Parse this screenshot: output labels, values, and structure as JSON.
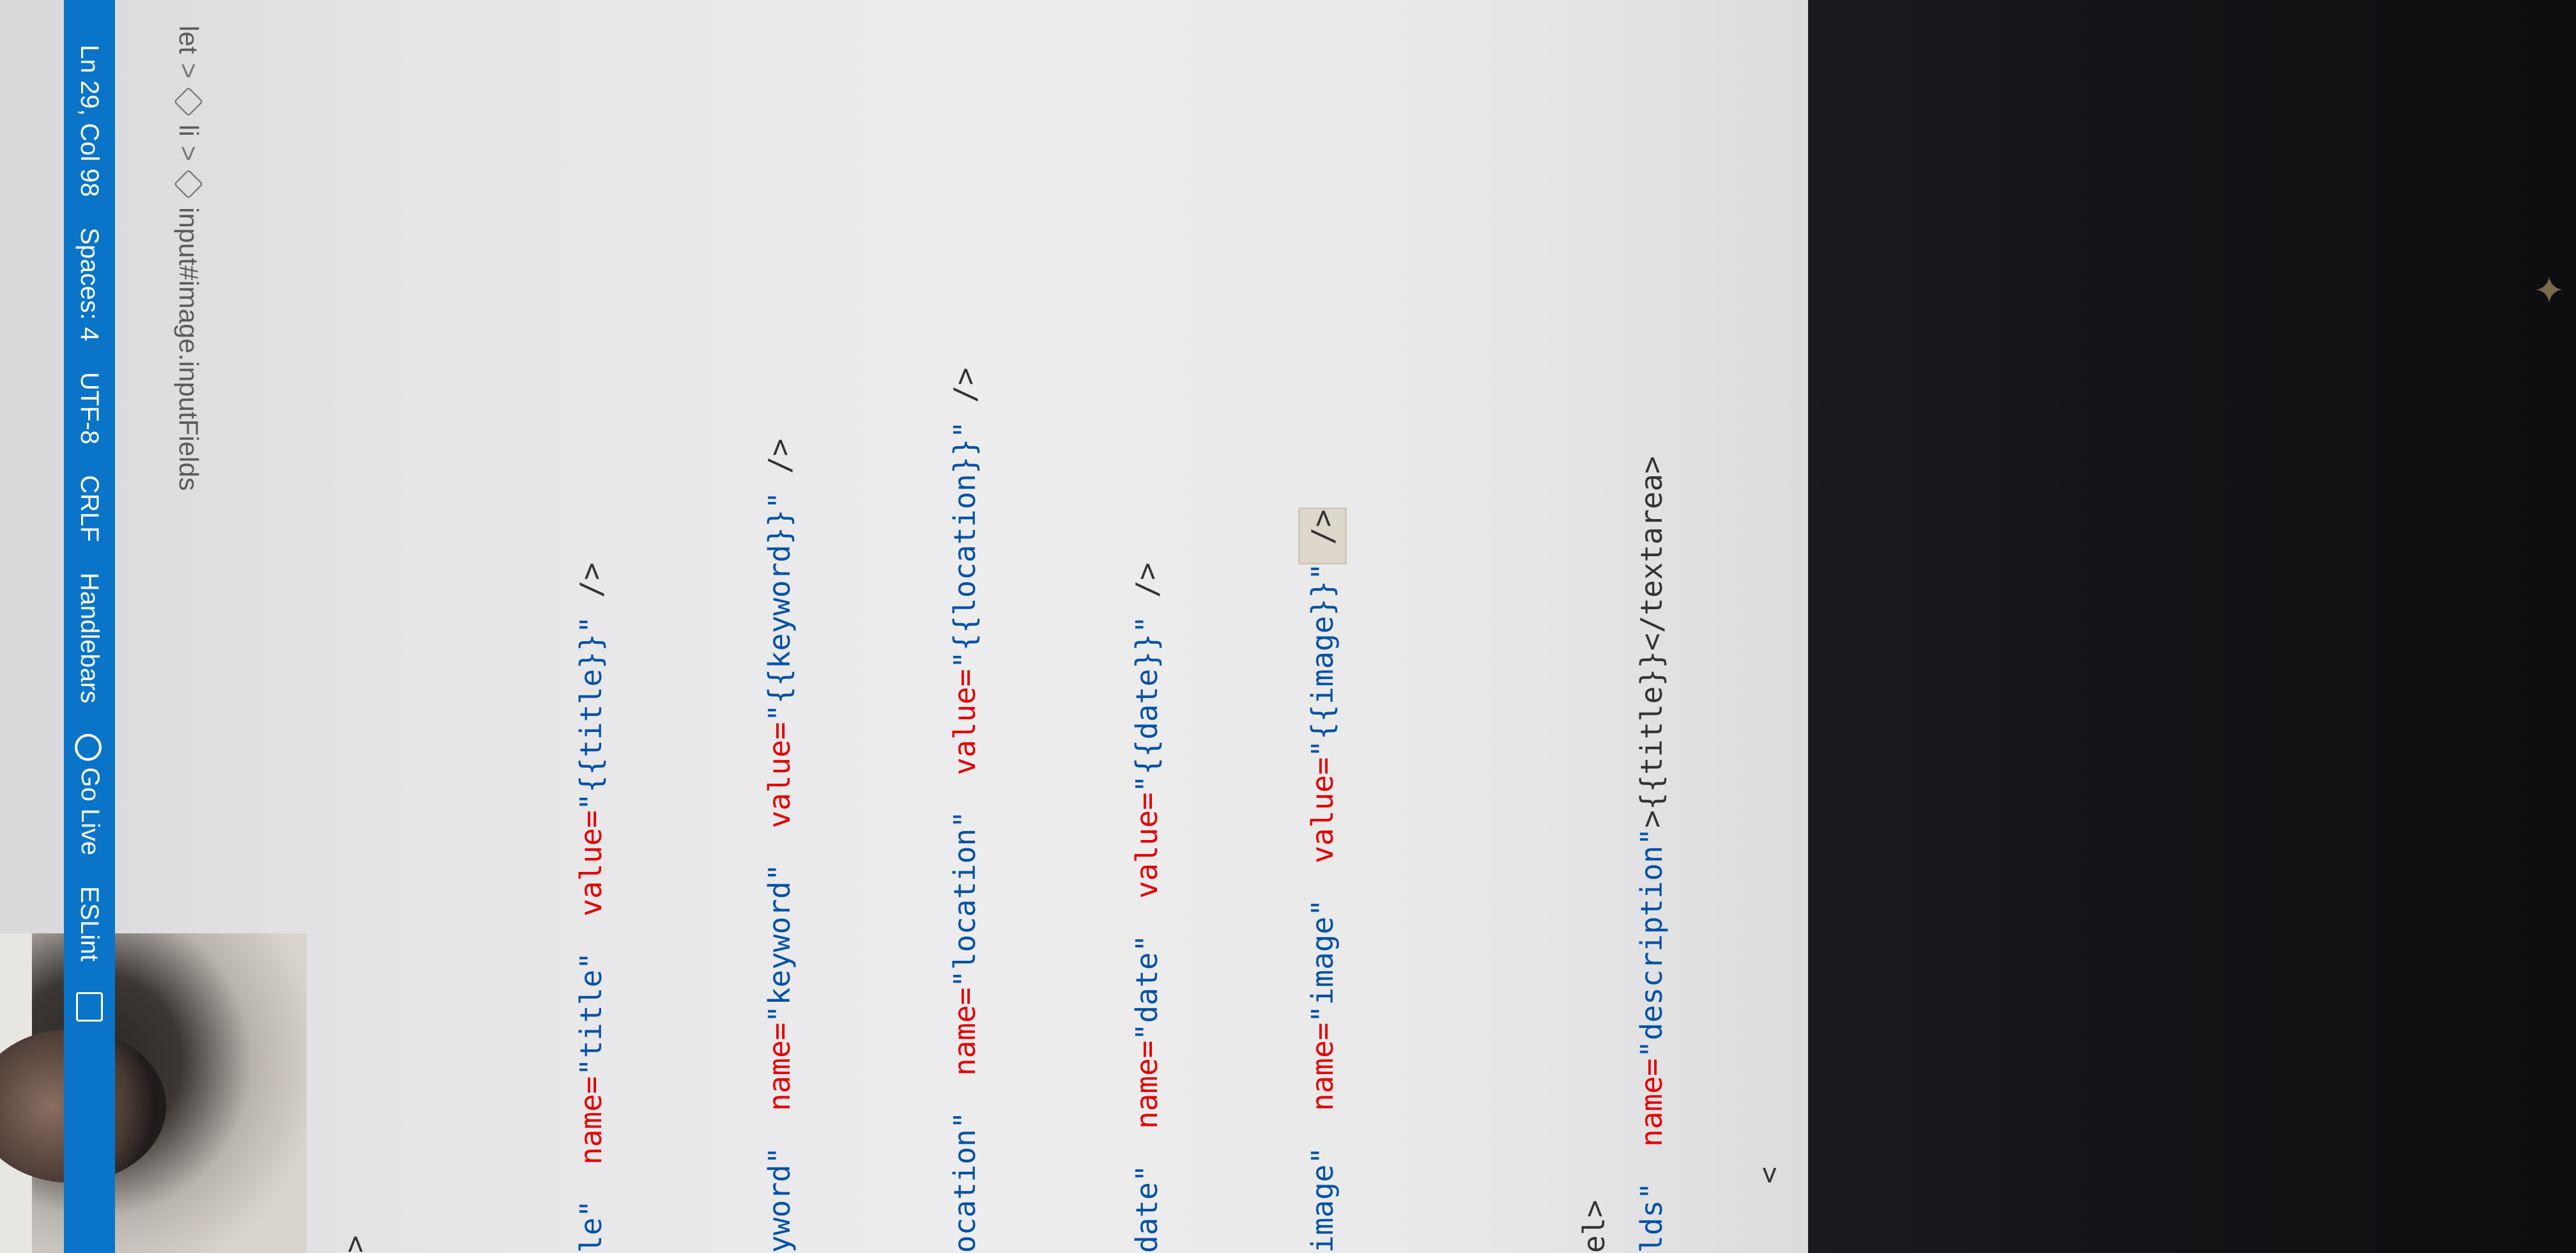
{
  "breadcrumb": {
    "items": [
      {
        "label": "let"
      },
      {
        "label": "li"
      },
      {
        "label": "input#image.inputFields"
      }
    ],
    "separator": ">"
  },
  "code_lines": [
    {
      "id": "gt",
      "text": ">"
    },
    {
      "id": "title",
      "prefix": "le\"",
      "attr1": "name=",
      "val1": "\"title\"",
      "attr2": "value=",
      "val2": "\"{{title}}\"",
      "suffix": " />"
    },
    {
      "id": "keyword",
      "prefix": "yword\"",
      "attr1": "name=",
      "val1": "\"keyword\"",
      "attr2": "value=",
      "val2": "\"{{keyword}}\"",
      "suffix": " />"
    },
    {
      "id": "location",
      "prefix": "ocation\"",
      "attr1": "name=",
      "val1": "\"location\"",
      "attr2": "value=",
      "val2": "\"{{location}}\"",
      "suffix": " />"
    },
    {
      "id": "date",
      "prefix": "date\"",
      "attr1": "name=",
      "val1": "\"date\"",
      "attr2": "value=",
      "val2": "\"{{date}}\"",
      "suffix": " />"
    },
    {
      "id": "image",
      "prefix": "image\"",
      "attr1": "name=",
      "val1": "\"image\"",
      "attr2": "value=",
      "val2": "\"{{image}}\"",
      "suffix": " />"
    },
    {
      "id": "el",
      "text": "el>"
    },
    {
      "id": "description",
      "prefix": "lds\"",
      "attr1": "name=",
      "val1": "\"description\"",
      "middle": ">{{title}}</textarea>"
    }
  ],
  "statusbar": {
    "position": "Ln 29, Col 98",
    "spaces": "Spaces: 4",
    "encoding": "UTF-8",
    "eol": "CRLF",
    "language": "Handlebars",
    "go_live": "Go Live",
    "eslint": "ESLint"
  },
  "colors": {
    "statusbar_bg": "#0a74c9",
    "attr": "#e50000",
    "value": "#0451a5"
  }
}
